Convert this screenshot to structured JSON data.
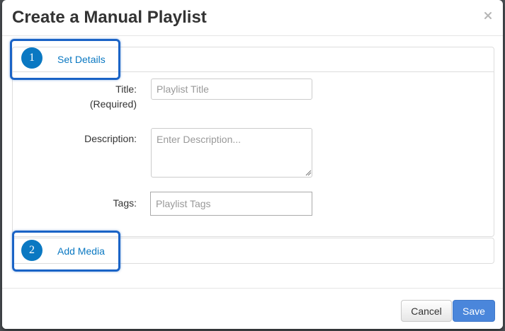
{
  "modal": {
    "title": "Create a Manual Playlist",
    "close_icon": "close-icon"
  },
  "steps": [
    {
      "number": "1",
      "label": "Set Details"
    },
    {
      "number": "2",
      "label": "Add Media"
    }
  ],
  "form": {
    "title_label": "Title:",
    "required_label": "(Required)",
    "title_placeholder": "Playlist Title",
    "title_value": "",
    "description_label": "Description:",
    "description_placeholder": "Enter Description...",
    "description_value": "",
    "tags_label": "Tags:",
    "tags_placeholder": "Playlist Tags",
    "tags_value": ""
  },
  "footer": {
    "cancel_label": "Cancel",
    "save_label": "Save"
  },
  "colors": {
    "accent": "#0a78c2",
    "highlight": "#1a63c6",
    "save_button": "#4a86db"
  }
}
